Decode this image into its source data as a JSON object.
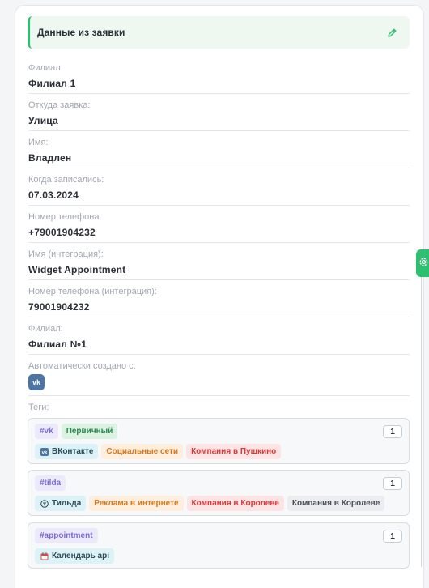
{
  "header": {
    "title": "Данные из заявки",
    "edit_icon": "pencil-icon"
  },
  "fields": [
    {
      "label": "Филиал:",
      "value": "Филиал 1"
    },
    {
      "label": "Откуда заявка:",
      "value": "Улица"
    },
    {
      "label": "Имя:",
      "value": "Владлен"
    },
    {
      "label": "Когда записались:",
      "value": "07.03.2024"
    },
    {
      "label": "Номер телефона:",
      "value": "+79001904232"
    },
    {
      "label": "Имя (интеграция):",
      "value": "Widget Appointment"
    },
    {
      "label": "Номер телефона (интеграция):",
      "value": "79001904232"
    },
    {
      "label": "Филиал:",
      "value": "Филиал №1"
    }
  ],
  "auto_created": {
    "label": "Автоматически создано с:",
    "icon": "vk-logo-icon"
  },
  "tags_label": "Теги:",
  "tag_groups": [
    {
      "hashtag": "#vk",
      "status": "Первичный",
      "count": "1",
      "chips": [
        "ВКонтакте",
        "Социальные сети",
        "Компания в Пушкино"
      ]
    },
    {
      "hashtag": "#tilda",
      "count": "1",
      "chips": [
        "Тильда",
        "Реклама в интернете",
        "Компания в Королеве",
        "Компания в Королеве"
      ]
    },
    {
      "hashtag": "#appointment",
      "count": "1",
      "chips": [
        "Календарь api"
      ]
    }
  ],
  "colors": {
    "accent": "#2fbf71",
    "vk": "#4c75a3",
    "hashtag": "#7b6ad6"
  }
}
